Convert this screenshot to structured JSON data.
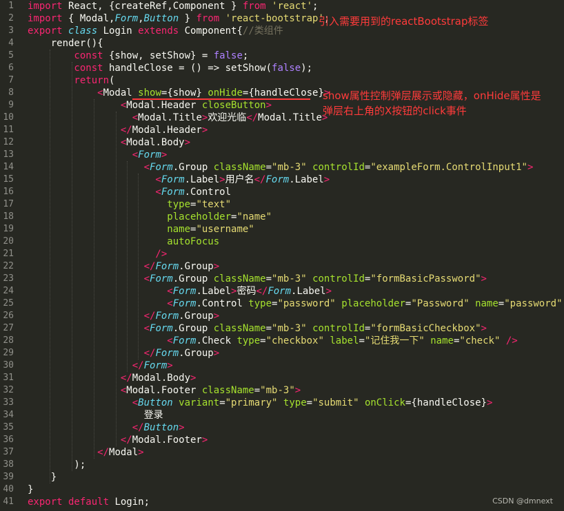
{
  "annotations": {
    "import_note": "引入需要用到的reactBootstrap标签",
    "show_note_1": "show属性控制弹层展示或隐藏，onHide属性是",
    "show_note_2": "弹层右上角的X按钮的click事件"
  },
  "watermark": "CSDN @dmnext",
  "code": {
    "l1": {
      "kw1": "import",
      "p1": " React, {createRef,Component } ",
      "kw2": "from",
      "s1": " 'react'",
      "p2": ";"
    },
    "l2": {
      "kw1": "import",
      "p1": " { Modal,",
      "t1": "Form",
      "p2": ",",
      "t2": "Button",
      "p3": " } ",
      "kw2": "from",
      "s1": " 'react-bootstrap'",
      "p4": ";"
    },
    "l3": {
      "kw1": "export",
      "t1": " class",
      "p1": " Login ",
      "kw2": "extends",
      "p2": " Component{",
      "c1": "//类组件"
    },
    "l4": {
      "p1": "    render(){"
    },
    "l5": {
      "kw1": "        const",
      "p1": " {show, setShow} = ",
      "b1": "false",
      "p2": ";"
    },
    "l6": {
      "kw1": "        const",
      "p1": " handleClose = () => setShow(",
      "b1": "false",
      "p2": ");"
    },
    "l7": {
      "kw1": "        return",
      "p1": "("
    },
    "l8": {
      "t1": "            <",
      "p1": "Modal ",
      "a1": "show",
      "p2": "=",
      "p3": "{show} ",
      "a2": "onHide",
      "p4": "=",
      "p5": "{handleClose}",
      "t2": ">"
    },
    "l9": {
      "t1": "                <",
      "p1": "Modal.Header ",
      "a1": "closeButton",
      "t2": ">"
    },
    "l10": {
      "t1": "                  <",
      "p1": "Modal.Title",
      "t2": ">",
      "p2": "欢迎光临",
      "t3": "</",
      "p3": "Modal.Title",
      "t4": ">"
    },
    "l11": {
      "t1": "                </",
      "p1": "Modal.Header",
      "t2": ">"
    },
    "l12": {
      "t1": "                <",
      "p1": "Modal.Body",
      "t2": ">"
    },
    "l13": {
      "t1": "                  <",
      "y1": "Form",
      "t2": ">"
    },
    "l14": {
      "t1": "                    <",
      "y1": "Form",
      "p1": ".Group ",
      "a1": "className",
      "p2": "=",
      "s1": "\"mb-3\"",
      "p3": " ",
      "a2": "controlId",
      "p4": "=",
      "s2": "\"exampleForm.ControlInput1\"",
      "t2": ">"
    },
    "l15": {
      "t1": "                      <",
      "y1": "Form",
      "p1": ".Label",
      "t2": ">",
      "p2": "用户名",
      "t3": "</",
      "y2": "Form",
      "p3": ".Label",
      "t4": ">"
    },
    "l16": {
      "t1": "                      <",
      "y1": "Form",
      "p1": ".Control"
    },
    "l17": {
      "a1": "                        type",
      "p1": "=",
      "s1": "\"text\""
    },
    "l18": {
      "a1": "                        placeholder",
      "p1": "=",
      "s1": "\"name\""
    },
    "l19": {
      "a1": "                        name",
      "p1": "=",
      "s1": "\"username\""
    },
    "l20": {
      "a1": "                        autoFocus"
    },
    "l21": {
      "t1": "                      />"
    },
    "l22": {
      "t1": "                    </",
      "y1": "Form",
      "p1": ".Group",
      "t2": ">"
    },
    "l23": {
      "t1": "                    <",
      "y1": "Form",
      "p1": ".Group ",
      "a1": "className",
      "p2": "=",
      "s1": "\"mb-3\"",
      "p3": " ",
      "a2": "controlId",
      "p4": "=",
      "s2": "\"formBasicPassword\"",
      "t2": ">"
    },
    "l24": {
      "t1": "                        <",
      "y1": "Form",
      "p1": ".Label",
      "t2": ">",
      "p2": "密码",
      "t3": "</",
      "y2": "Form",
      "p3": ".Label",
      "t4": ">"
    },
    "l25": {
      "t1": "                        <",
      "y1": "Form",
      "p1": ".Control ",
      "a1": "type",
      "p2": "=",
      "s1": "\"password\"",
      "p3": " ",
      "a2": "placeholder",
      "p4": "=",
      "s2": "\"Password\"",
      "p5": " ",
      "a3": "name",
      "p6": "=",
      "s3": "\"password\"",
      "t2": " />"
    },
    "l26": {
      "t1": "                    </",
      "y1": "Form",
      "p1": ".Group",
      "t2": ">"
    },
    "l27": {
      "t1": "                    <",
      "y1": "Form",
      "p1": ".Group ",
      "a1": "className",
      "p2": "=",
      "s1": "\"mb-3\"",
      "p3": " ",
      "a2": "controlId",
      "p4": "=",
      "s2": "\"formBasicCheckbox\"",
      "t2": ">"
    },
    "l28": {
      "t1": "                        <",
      "y1": "Form",
      "p1": ".Check ",
      "a1": "type",
      "p2": "=",
      "s1": "\"checkbox\"",
      "p3": " ",
      "a2": "label",
      "p4": "=",
      "s2": "\"记住我一下\"",
      "p5": " ",
      "a3": "name",
      "p6": "=",
      "s3": "\"check\"",
      "t2": " />"
    },
    "l29": {
      "t1": "                    </",
      "y1": "Form",
      "p1": ".Group",
      "t2": ">"
    },
    "l30": {
      "t1": "                  </",
      "y1": "Form",
      "t2": ">"
    },
    "l31": {
      "t1": "                </",
      "p1": "Modal.Body",
      "t2": ">"
    },
    "l32": {
      "t1": "                <",
      "p1": "Modal.Footer ",
      "a1": "className",
      "p2": "=",
      "s1": "\"mb-3\"",
      "t2": ">"
    },
    "l33": {
      "t1": "                  <",
      "y1": "Button",
      "p1": " ",
      "a1": "variant",
      "p2": "=",
      "s1": "\"primary\"",
      "p3": " ",
      "a2": "type",
      "p4": "=",
      "s2": "\"submit\"",
      "p5": " ",
      "a3": "onClick",
      "p6": "=",
      "p7": "{handleClose}",
      "t2": ">"
    },
    "l34": {
      "p1": "                    登录"
    },
    "l35": {
      "t1": "                  </",
      "y1": "Button",
      "t2": ">"
    },
    "l36": {
      "t1": "                </",
      "p1": "Modal.Footer",
      "t2": ">"
    },
    "l37": {
      "t1": "            </",
      "p1": "Modal",
      "t2": ">"
    },
    "l38": {
      "p1": "        );"
    },
    "l39": {
      "p1": "    }"
    },
    "l40": {
      "p1": "}"
    },
    "l41": {
      "kw1": "export",
      "kw2": " default",
      "p1": " Login;"
    }
  },
  "line_numbers": [
    "1",
    "2",
    "3",
    "4",
    "5",
    "6",
    "7",
    "8",
    "9",
    "10",
    "11",
    "12",
    "13",
    "14",
    "15",
    "16",
    "17",
    "18",
    "19",
    "20",
    "21",
    "22",
    "23",
    "24",
    "25",
    "26",
    "27",
    "28",
    "29",
    "30",
    "31",
    "32",
    "33",
    "34",
    "35",
    "36",
    "37",
    "38",
    "39",
    "40",
    "41"
  ]
}
